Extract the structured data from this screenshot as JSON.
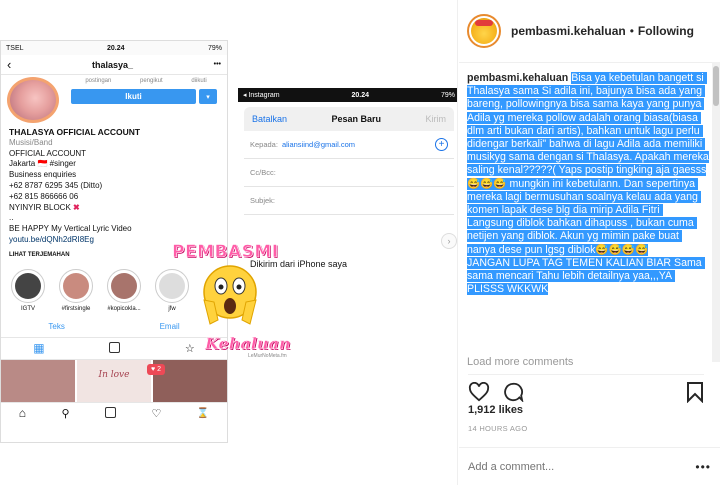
{
  "post_image": {
    "phone1": {
      "status": {
        "carrier": "TSEL",
        "time": "20.24",
        "battery": "79%"
      },
      "header": {
        "back": "‹",
        "username": "thalasya_",
        "more": "•••"
      },
      "stats": [
        "postingan",
        "pengikut",
        "diikuti"
      ],
      "follow_label": "Ikuti",
      "bio": {
        "name": "THALASYA OFFICIAL ACCOUNT",
        "category": "Musisi/Band",
        "lines": [
          "OFFICIAL ACCOUNT",
          "Jakarta 🇮🇩 #singer",
          "Business enquiries",
          "+62 8787 6295 345 (Ditto)",
          "+62 815 866666 06",
          "NYINYIR BLOCK"
        ],
        "x_mark": "✖",
        "dots": "..",
        "video": "BE HAPPY My Vertical Lyric Video",
        "link": "youtu.be/dQNh2dRI8Eg",
        "translate": "LIHAT TERJEMAHAN"
      },
      "highlights": [
        {
          "label": "IGTV",
          "color": "#444"
        },
        {
          "label": "#firstsingle",
          "color": "#c98b7f"
        },
        {
          "label": "#kopicokla...",
          "color": "#a8746c"
        },
        {
          "label": "jfw",
          "color": "#ddd"
        }
      ],
      "tabs_text": [
        "Teks",
        "Email"
      ],
      "grid_colors": [
        "#b98a86",
        "#f1e4e2",
        "#8f5f5a"
      ],
      "grid_caption": "In love",
      "notif_count": "2"
    },
    "phone2": {
      "status": {
        "app": "◂ Instagram",
        "time": "20.24",
        "battery": "79%"
      },
      "bar": {
        "cancel": "Batalkan",
        "title": "Pesan Baru",
        "send": "Kirim"
      },
      "rows": [
        {
          "label": "Kepada:",
          "value": "aliansiind@gmail.com"
        },
        {
          "label": "Cc/Bcc:",
          "value": ""
        },
        {
          "label": "Subjek:",
          "value": ""
        }
      ],
      "body_text": "Dikirim dari iPhone saya"
    },
    "watermark": {
      "title": "PEMBASMI",
      "subtitle": "Kehaluan",
      "credit": "LeMurNoMeta.fm"
    }
  },
  "sidebar": {
    "header": {
      "username": "pembasmi.kehaluan",
      "separator": "•",
      "following": "Following"
    },
    "caption": {
      "username": "pembasmi.kehaluan",
      "text": "Bisa ya kebetulan bangett si Thalasya sama Si adila ini, bajunya bisa ada yang bareng, pollowingnya bisa sama kaya yang punya Adila yg mereka pollow adalah orang biasa(biasa dlm arti bukan dari artis), bahkan untuk lagu perlu didengar berkali\" bahwa di lagu Adila ada memiliki musikyg sama dengan si Thalasya. Apakah mereka saling kenal?????( Yaps postip tingking aja gaesss😅😅😅 mungkin ini kebetulann. Dan sepertinya mereka lagi bermusuhan soalnya kelau ada yang komen lapak dese blg dia mirip Adila Fitri Langsung diblok bahkan dihapuss , bukan cuma netijen yang diblok. Akun yg mimin pake buat nanya dese pun lgsg diblok😅😅😅😅\nJANGAN LUPA TAG TEMEN KALIAN BIAR Sama sama mencari Tahu lebih detailnya yaa,,,YA PLISSS WKKWK"
    },
    "load_more": "Load more comments",
    "likes": "1,912 likes",
    "time": "14 HOURS AGO",
    "comment_placeholder": "Add a comment...",
    "more": "•••"
  }
}
